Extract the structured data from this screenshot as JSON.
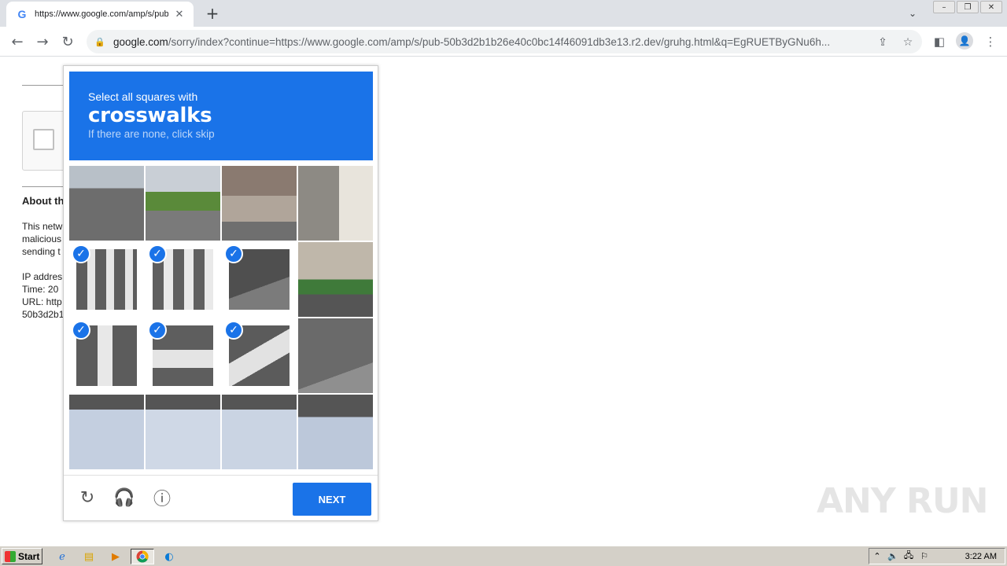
{
  "browser": {
    "tab": {
      "favicon": "G",
      "title": "https://www.google.com/amp/s/pub"
    },
    "url_domain": "google.com",
    "url_path": "/sorry/index?continue=https://www.google.com/amp/s/pub-50b3d2b1b26e40c0bc14f46091db3e13.r2.dev/gruhg.html&q=EgRUETByGNu6h..."
  },
  "background_page": {
    "about_heading": "About th",
    "line1": "This netw",
    "line2": "malicious",
    "line3": "sending t",
    "ip": "IP addres",
    "time": "Time: 20",
    "url": "URL: http",
    "url2": "50b3d2b1"
  },
  "captcha": {
    "instruction": "Select all squares with",
    "target": "crosswalks",
    "hint": "If there are none, click skip",
    "next_label": "NEXT",
    "selected_tiles": [
      4,
      5,
      6,
      8,
      9,
      10
    ]
  },
  "watermark": "ANY RUN",
  "taskbar": {
    "start_label": "Start",
    "clock": "3:22 AM"
  }
}
